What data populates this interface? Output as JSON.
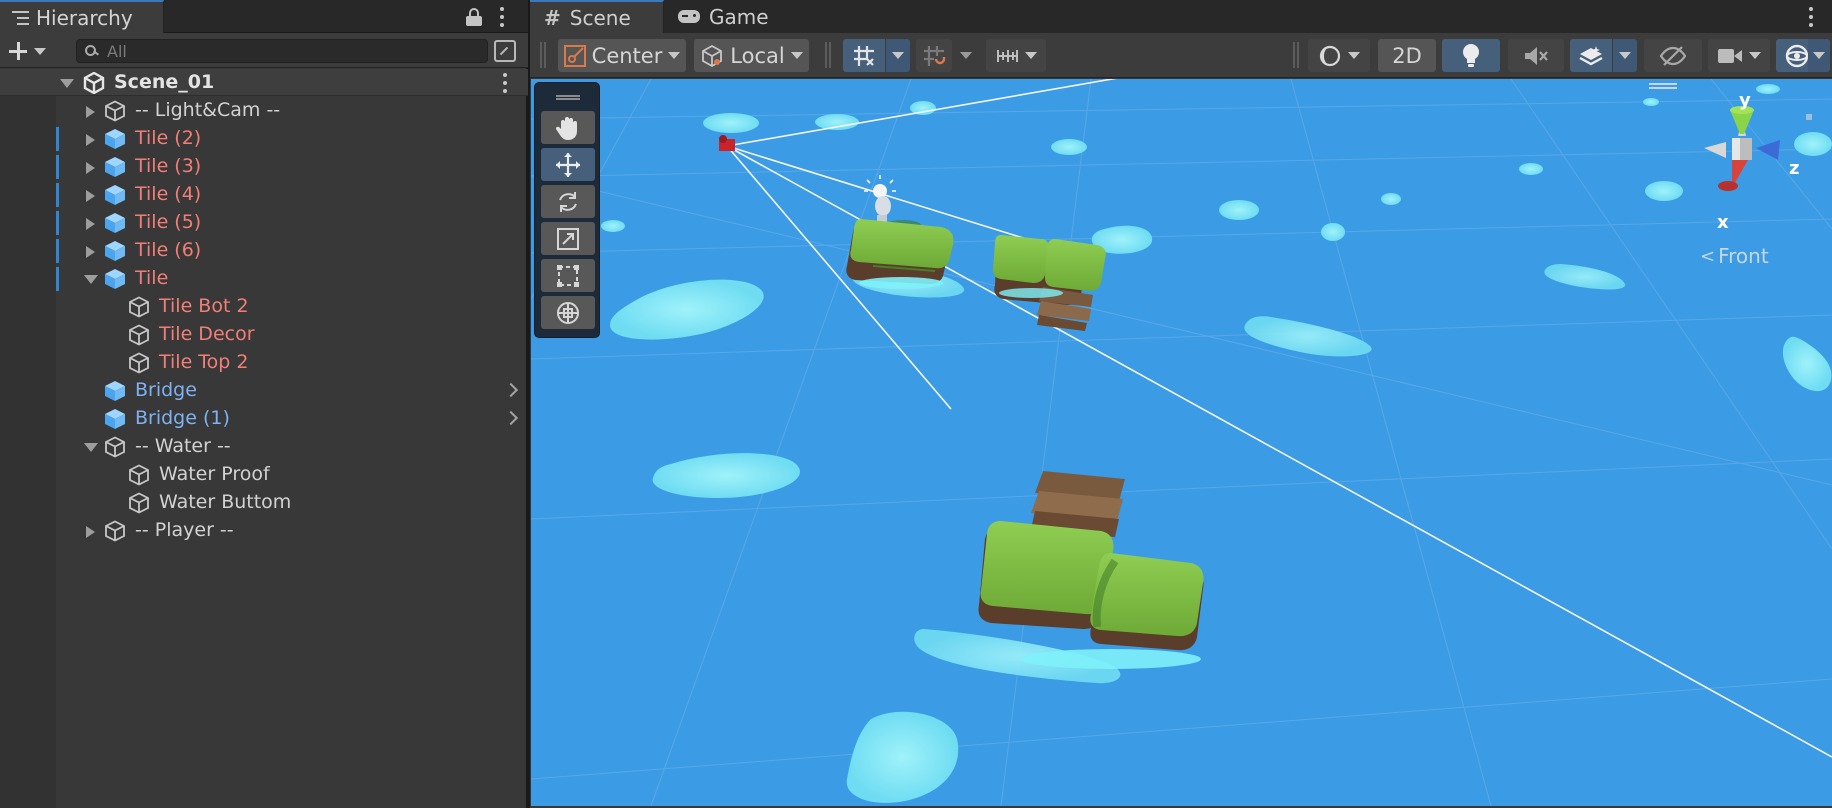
{
  "hierarchy": {
    "tab_title": "Hierarchy",
    "search_placeholder": "All",
    "scene_name": "Scene_01",
    "items": [
      {
        "label": "-- Light&Cam --",
        "color": "white",
        "icon": "empty-cube-icon",
        "expand": "collapsed"
      },
      {
        "label": "Tile (2)",
        "color": "red",
        "icon": "prefab-cube-icon",
        "expand": "collapsed"
      },
      {
        "label": "Tile (3)",
        "color": "red",
        "icon": "prefab-cube-icon",
        "expand": "collapsed"
      },
      {
        "label": "Tile (4)",
        "color": "red",
        "icon": "prefab-cube-icon",
        "expand": "collapsed"
      },
      {
        "label": "Tile (5)",
        "color": "red",
        "icon": "prefab-cube-icon",
        "expand": "collapsed"
      },
      {
        "label": "Tile (6)",
        "color": "red",
        "icon": "prefab-cube-icon",
        "expand": "collapsed"
      },
      {
        "label": "Tile",
        "color": "red",
        "icon": "prefab-cube-icon",
        "expand": "expanded"
      },
      {
        "label": "Tile Bot 2",
        "color": "red",
        "icon": "empty-cube-icon",
        "expand": "none"
      },
      {
        "label": "Tile Decor",
        "color": "red",
        "icon": "empty-cube-icon",
        "expand": "none"
      },
      {
        "label": "Tile Top 2",
        "color": "red",
        "icon": "empty-cube-icon",
        "expand": "none"
      },
      {
        "label": "Bridge",
        "color": "blue",
        "icon": "prefab-cube-icon",
        "expand": "none"
      },
      {
        "label": "Bridge (1)",
        "color": "blue",
        "icon": "prefab-cube-icon",
        "expand": "none"
      },
      {
        "label": "-- Water --",
        "color": "white",
        "icon": "empty-cube-icon",
        "expand": "expanded"
      },
      {
        "label": "Water Proof",
        "color": "white",
        "icon": "empty-cube-icon",
        "expand": "none"
      },
      {
        "label": "Water Buttom",
        "color": "white",
        "icon": "empty-cube-icon",
        "expand": "none"
      },
      {
        "label": "-- Player --",
        "color": "white",
        "icon": "empty-cube-icon",
        "expand": "collapsed"
      }
    ]
  },
  "scene": {
    "tabs": [
      {
        "label": "Scene",
        "icon": "hash-icon",
        "active": true
      },
      {
        "label": "Game",
        "icon": "gamepad-icon",
        "active": false
      }
    ],
    "toolbar": {
      "pivot_label": "Center",
      "space_label": "Local",
      "mode_2d_label": "2D"
    },
    "gizmo": {
      "y": "y",
      "x": "x",
      "z": "z",
      "view_label": "Front"
    }
  },
  "colors": {
    "accent": "#3a79bb",
    "prefab_override_red": "#f17f78",
    "prefab_blue": "#7fb2f2",
    "sky": "#3c9be5"
  }
}
